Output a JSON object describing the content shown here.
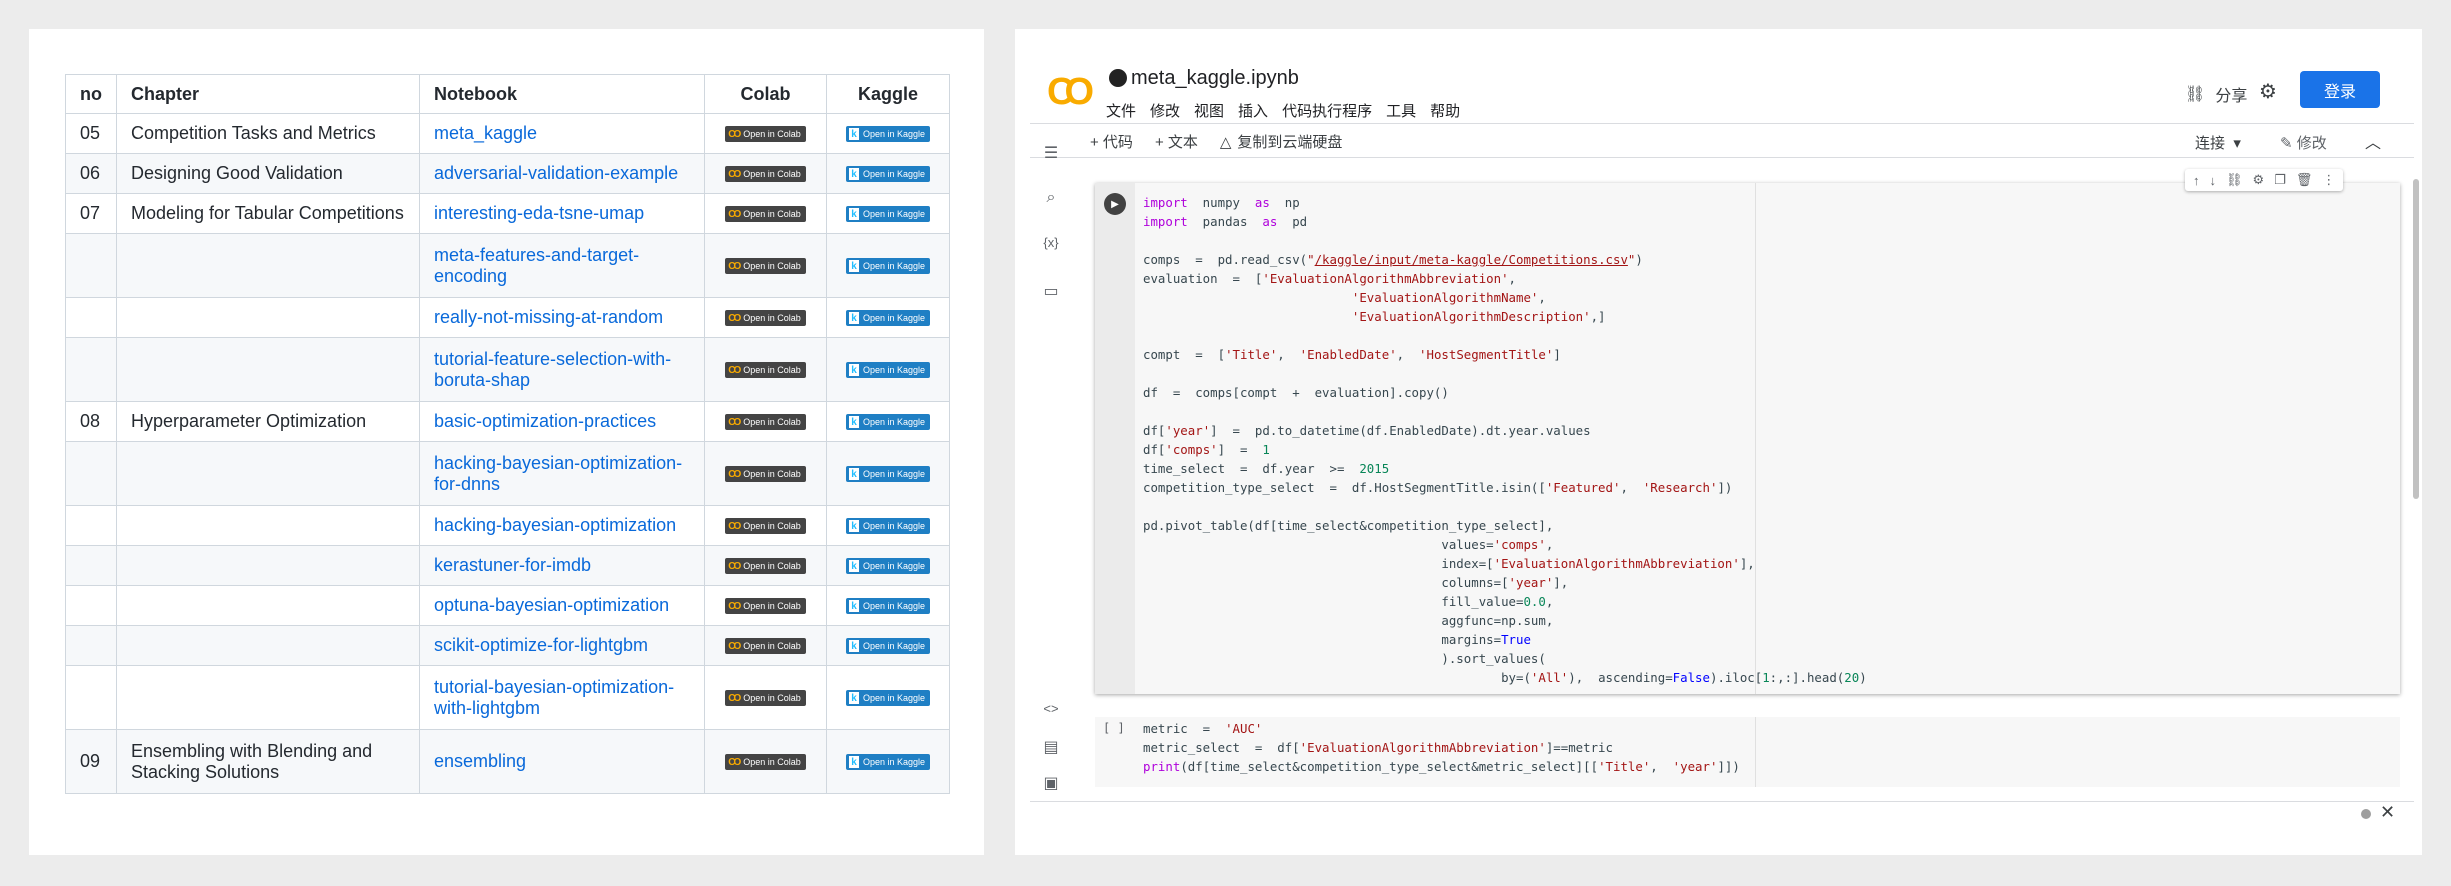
{
  "table": {
    "headers": [
      "no",
      "Chapter",
      "Notebook",
      "Colab",
      "Kaggle"
    ],
    "badges": {
      "colab": "Open in Colab",
      "kaggle": "Open in Kaggle"
    },
    "rows": [
      {
        "no": "05",
        "chapter": "Competition Tasks and Metrics",
        "notebook": "meta_kaggle"
      },
      {
        "no": "06",
        "chapter": "Designing Good Validation",
        "notebook": "adversarial-validation-example"
      },
      {
        "no": "07",
        "chapter": "Modeling for Tabular Competitions",
        "notebook": "interesting-eda-tsne-umap"
      },
      {
        "no": "",
        "chapter": "",
        "notebook": "meta-features-and-target-encoding"
      },
      {
        "no": "",
        "chapter": "",
        "notebook": "really-not-missing-at-random"
      },
      {
        "no": "",
        "chapter": "",
        "notebook": "tutorial-feature-selection-with-boruta-shap"
      },
      {
        "no": "08",
        "chapter": "Hyperparameter Optimization",
        "notebook": "basic-optimization-practices"
      },
      {
        "no": "",
        "chapter": "",
        "notebook": "hacking-bayesian-optimization-for-dnns"
      },
      {
        "no": "",
        "chapter": "",
        "notebook": "hacking-bayesian-optimization"
      },
      {
        "no": "",
        "chapter": "",
        "notebook": "kerastuner-for-imdb"
      },
      {
        "no": "",
        "chapter": "",
        "notebook": "optuna-bayesian-optimization"
      },
      {
        "no": "",
        "chapter": "",
        "notebook": "scikit-optimize-for-lightgbm"
      },
      {
        "no": "",
        "chapter": "",
        "notebook": "tutorial-bayesian-optimization-with-lightgbm"
      },
      {
        "no": "09",
        "chapter": "Ensembling with Blending and Stacking Solutions",
        "notebook": "ensembling"
      }
    ]
  },
  "colab": {
    "filename": "meta_kaggle.ipynb",
    "menu": [
      "文件",
      "修改",
      "视图",
      "插入",
      "代码执行程序",
      "工具",
      "帮助"
    ],
    "share_label": "分享",
    "login_label": "登录",
    "toolbar": {
      "add_code": "+ 代码",
      "add_text": "+ 文本",
      "copy_to_drive": "复制到云端硬盘",
      "connect": "连接",
      "edit": "修改"
    },
    "cell2_bracket": "[ ]",
    "colors": {
      "accent": "#1a73e8",
      "logo": "#f9ab00"
    }
  }
}
